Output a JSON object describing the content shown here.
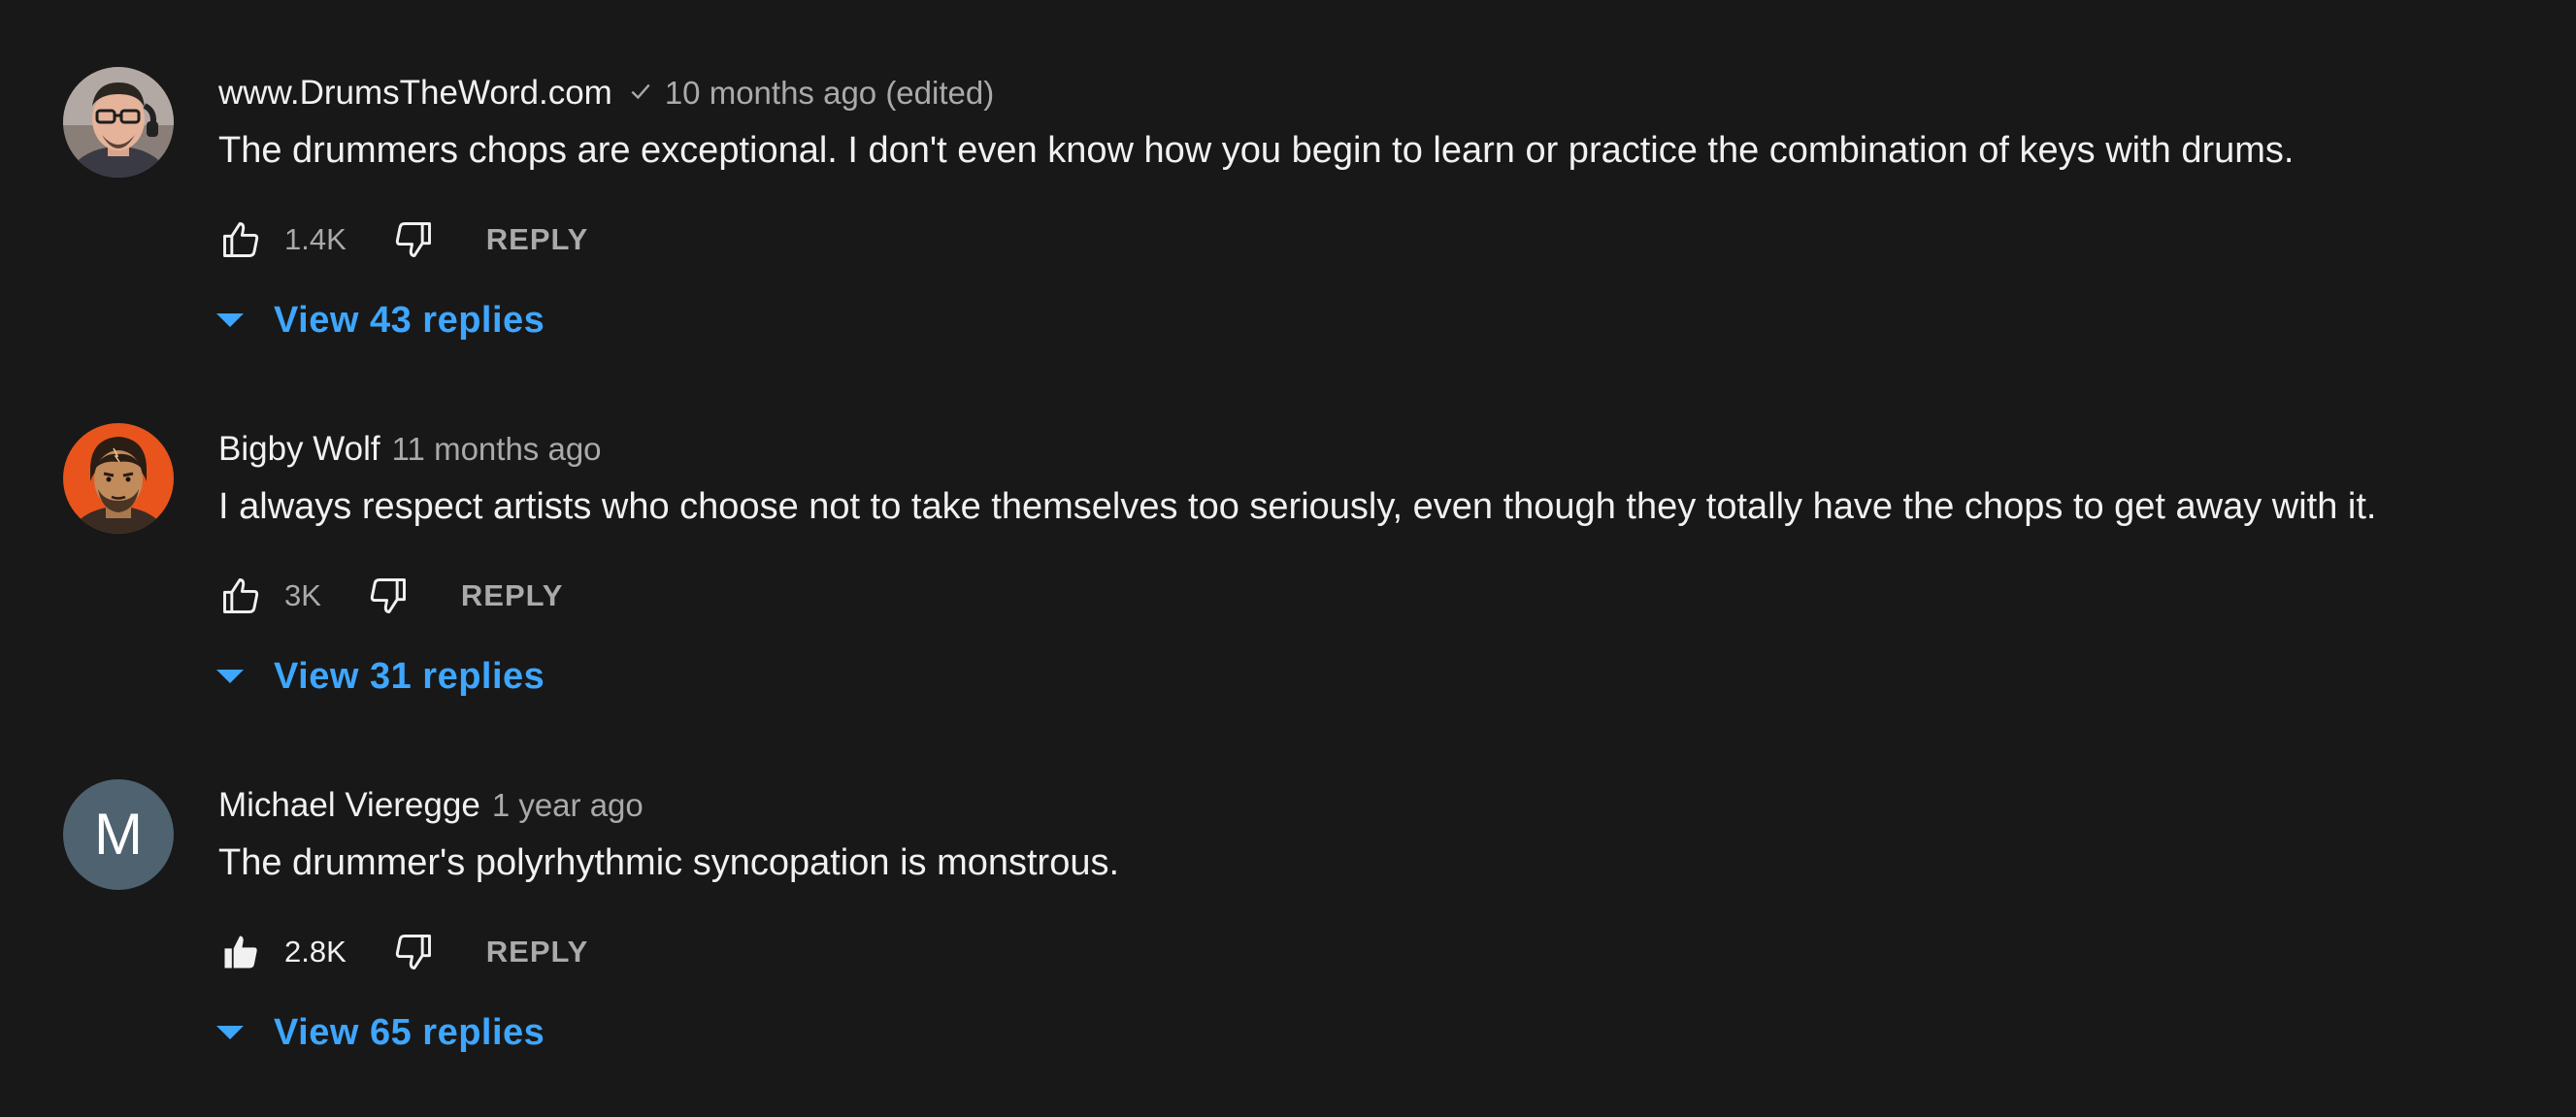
{
  "comments": [
    {
      "author": "www.DrumsTheWord.com",
      "verified": true,
      "time": "10 months ago (edited)",
      "text": "The drummers chops are exceptional. I don't even know how you begin to learn or practice the combination of keys with drums.",
      "likes": "1.4K",
      "liked": false,
      "reply_label": "REPLY",
      "replies_label": "View 43 replies",
      "avatar": {
        "type": "photo",
        "icon": "user-photo-avatar"
      }
    },
    {
      "author": "Bigby Wolf",
      "verified": false,
      "time": "11 months ago",
      "text": "I always respect artists who choose not to take themselves too seriously, even though they totally have the chops to get away with it.",
      "likes": "3K",
      "liked": false,
      "reply_label": "REPLY",
      "replies_label": "View 31 replies",
      "avatar": {
        "type": "illustration",
        "icon": "bigby-wolf-avatar",
        "background": "#e8541c"
      }
    },
    {
      "author": "Michael Vieregge",
      "verified": false,
      "time": "1 year ago",
      "text": "The drummer's polyrhythmic syncopation is monstrous.",
      "likes": "2.8K",
      "liked": true,
      "reply_label": "REPLY",
      "replies_label": "View 65 replies",
      "avatar": {
        "type": "letter",
        "letter": "M",
        "background": "#4e6270"
      }
    }
  ],
  "icons": {
    "like": "thumb-up-icon",
    "dislike": "thumb-down-icon",
    "expand": "caret-down-icon",
    "verified": "checkmark-icon"
  },
  "colors": {
    "background": "#181818",
    "text": "#f1f1f1",
    "secondary_text": "#aaaaaa",
    "link": "#3ea6ff"
  }
}
